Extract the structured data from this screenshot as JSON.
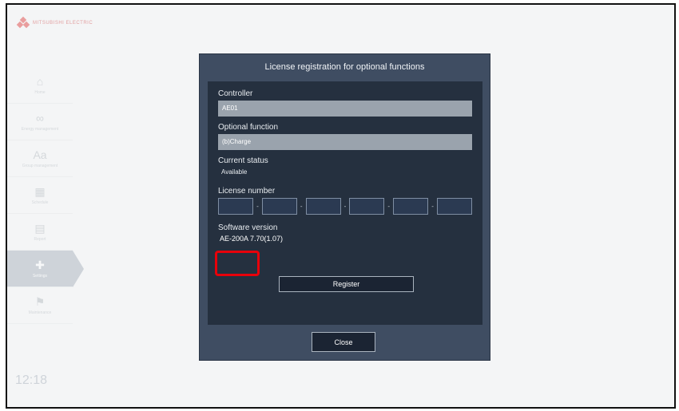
{
  "app": {
    "logo_text": "MITSUBISHI ELECTRIC"
  },
  "sidebar": {
    "items": [
      {
        "icon": "home-icon",
        "glyph": "⌂",
        "label": "Home",
        "active": false
      },
      {
        "icon": "infinity-icon",
        "glyph": "∞",
        "label": "Energy management",
        "active": false
      },
      {
        "icon": "text-size-icon",
        "glyph": "Aa",
        "label": "Group management",
        "active": false
      },
      {
        "icon": "calendar-icon",
        "glyph": "▦",
        "label": "Schedule",
        "active": false
      },
      {
        "icon": "document-icon",
        "glyph": "▤",
        "label": "Report",
        "active": false
      },
      {
        "icon": "settings-icon",
        "glyph": "✚",
        "label": "Settings",
        "active": true
      },
      {
        "icon": "maintenance-icon",
        "glyph": "⚑",
        "label": "Maintenance",
        "active": false
      }
    ]
  },
  "clock": {
    "time": "12:18",
    "date": ""
  },
  "dialog": {
    "title": "License registration for optional functions",
    "controller_label": "Controller",
    "controller_value": "AE01",
    "optional_function_label": "Optional function",
    "optional_function_value": "(b)Charge",
    "current_status_label": "Current status",
    "current_status_value": "Available",
    "license_number_label": "License number",
    "license_separator": "-",
    "license_segments": [
      "",
      "",
      "",
      "",
      "",
      ""
    ],
    "software_version_label": "Software version",
    "software_version_value": "AE-200A 7.70(1.07)",
    "register_label": "Register",
    "close_label": "Close"
  },
  "annotation": {
    "highlight_color": "#e8000a"
  },
  "colors": {
    "dialog_bg": "#3f4d62",
    "panel_bg": "#25303f",
    "field_bg": "#9aa3ad",
    "button_bg": "#1b2433"
  }
}
